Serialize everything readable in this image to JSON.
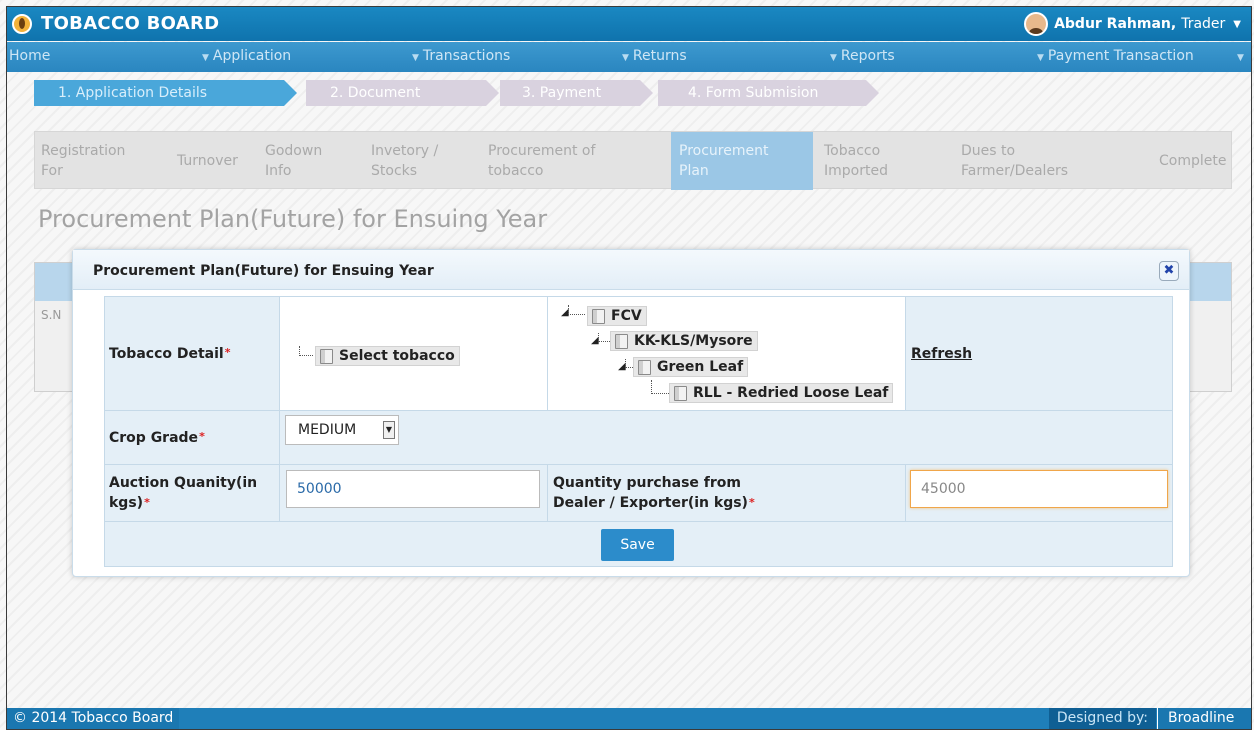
{
  "header": {
    "brand": "TOBACCO BOARD",
    "user_name": "Abdur Rahman,",
    "user_role": "Trader"
  },
  "nav": {
    "home": "Home",
    "items": [
      "Application",
      "Transactions",
      "Returns",
      "Reports",
      "Payment Transaction"
    ]
  },
  "wizard": {
    "steps": [
      "1. Application Details",
      "2. Document",
      "3. Payment",
      "4. Form Submision"
    ],
    "active_index": 0
  },
  "tabs": [
    {
      "line1": "Registration",
      "line2": "For"
    },
    {
      "line1": "Turnover",
      "line2": ""
    },
    {
      "line1": "Godown",
      "line2": "Info"
    },
    {
      "line1": "Invetory /",
      "line2": "Stocks"
    },
    {
      "line1": "Procurement of",
      "line2": "tobacco"
    },
    {
      "line1": "Procurement",
      "line2": "Plan"
    },
    {
      "line1": "Tobacco",
      "line2": "Imported"
    },
    {
      "line1": "Dues to",
      "line2": "Farmer/Dealers"
    },
    {
      "line1": "Complete",
      "line2": ""
    }
  ],
  "page_title": "Procurement Plan(Future) for Ensuing Year",
  "underlying": {
    "sno_header": "S.N"
  },
  "modal": {
    "title": "Procurement Plan(Future) for Ensuing Year",
    "close_glyph": "✖",
    "tobacco_detail_label": "Tobacco Detail",
    "select_tobacco": "Select tobacco",
    "tree": [
      "FCV",
      "KK-KLS/Mysore",
      "Green Leaf",
      "RLL - Redried Loose Leaf"
    ],
    "refresh": "Refresh",
    "crop_grade_label": "Crop Grade",
    "crop_grade_value": "MEDIUM",
    "auction_qty_label_1": "Auction Quanity(in",
    "auction_qty_label_2": "kgs)",
    "auction_qty_value": "50000",
    "dealer_qty_label_1": "Quantity purchase from",
    "dealer_qty_label_2": "Dealer / Exporter(in kgs)",
    "dealer_qty_value": "45000",
    "save": "Save",
    "required_mark": "*"
  },
  "footer": {
    "copyright": "© 2014 Tobacco Board",
    "designed_by": "Designed by:",
    "designer": "Broadline"
  },
  "colors": {
    "header_blue": "#1a88c2",
    "nav_blue": "#3d99cf",
    "active_tab": "#9bc7e6",
    "focus_orange": "#f0a64a",
    "save_button": "#2c8ccb"
  }
}
